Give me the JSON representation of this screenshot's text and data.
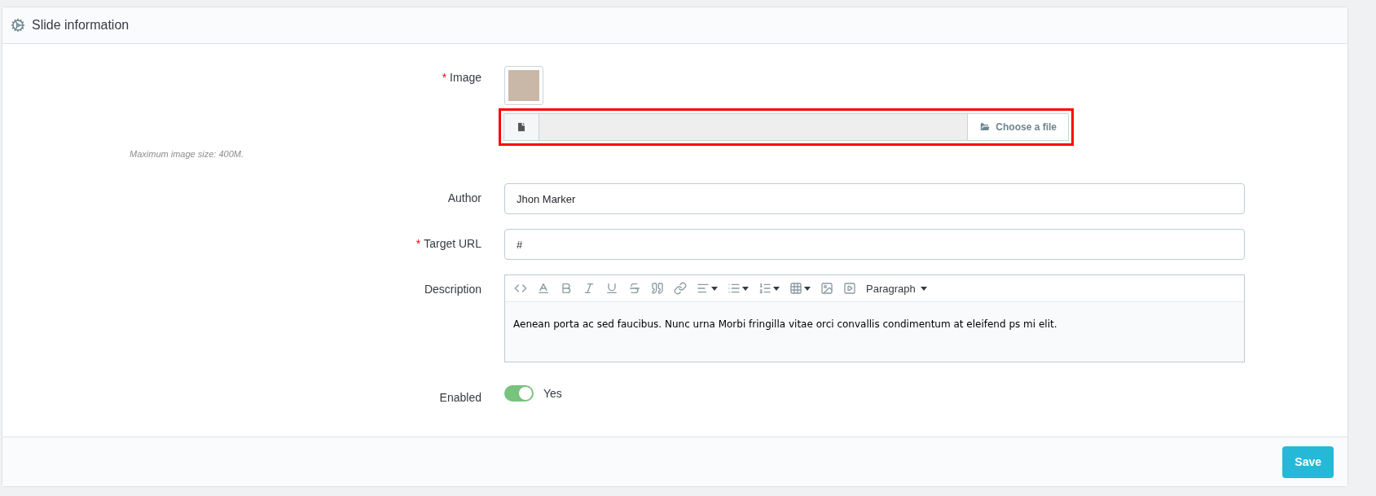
{
  "panel": {
    "title": "Slide information"
  },
  "image_field": {
    "label": "Image",
    "marker": "*",
    "help": "Maximum image size: 400M.",
    "button": "Choose a file",
    "highlighted": true
  },
  "fields": [
    {
      "label": "Author",
      "value": "Jhon Marker"
    },
    {
      "label": "Target URL",
      "marker": "*",
      "value": "#"
    }
  ],
  "description": {
    "label": "Description",
    "toolbar": [
      {
        "kind": "code",
        "dropdown": false
      },
      {
        "kind": "text-color",
        "dropdown": false
      },
      {
        "kind": "bold",
        "dropdown": false
      },
      {
        "kind": "italic",
        "dropdown": false
      },
      {
        "kind": "underline",
        "dropdown": false
      },
      {
        "kind": "strike",
        "dropdown": false
      },
      {
        "kind": "quote",
        "dropdown": false
      },
      {
        "kind": "link",
        "dropdown": false
      },
      {
        "kind": "align",
        "dropdown": true
      },
      {
        "kind": "bullets",
        "dropdown": true
      },
      {
        "kind": "numbers",
        "dropdown": true
      },
      {
        "kind": "table",
        "dropdown": true
      },
      {
        "kind": "picture",
        "dropdown": false
      },
      {
        "kind": "video",
        "dropdown": false
      }
    ],
    "format": "Paragraph",
    "text": "Aenean porta ac sed faucibus. Nunc urna Morbi fringilla vitae orci convallis condimentum at eleifend ps mi elit."
  },
  "enabled": {
    "label": "Enabled",
    "on": true,
    "text": "Yes"
  },
  "footer": {
    "button": "Save"
  }
}
